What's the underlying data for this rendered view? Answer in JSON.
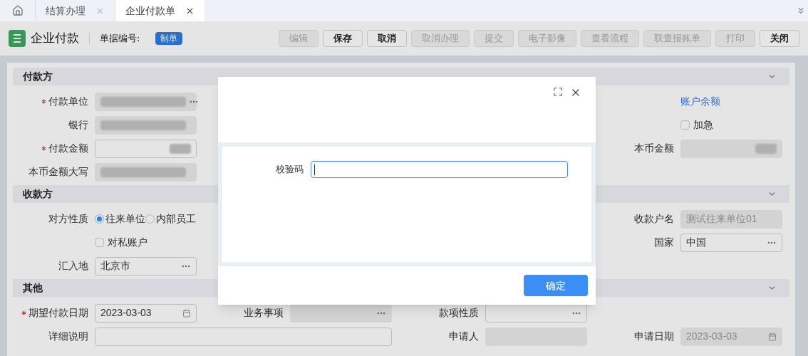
{
  "tabs": [
    {
      "kind": "home",
      "selected": false
    },
    {
      "kind": "tab",
      "label": "结算办理",
      "selected": false
    },
    {
      "kind": "tab",
      "label": "企业付款单",
      "selected": true
    }
  ],
  "toolbar": {
    "title": "企业付款",
    "number_label": "单据编号:",
    "status_badge": "制单",
    "buttons": [
      {
        "label": "编辑",
        "disabled": true
      },
      {
        "label": "保存",
        "disabled": false
      },
      {
        "label": "取消",
        "disabled": false
      },
      {
        "label": "取消办理",
        "disabled": true
      },
      {
        "label": "提交",
        "disabled": true
      },
      {
        "label": "电子影像",
        "disabled": true
      },
      {
        "label": "查看流程",
        "disabled": true
      },
      {
        "label": "联查报账单",
        "disabled": true
      },
      {
        "label": "打印",
        "disabled": true
      },
      {
        "label": "关闭",
        "disabled": false
      }
    ]
  },
  "sections": [
    {
      "title": "付款方",
      "expanded": true,
      "rows": [
        [
          {
            "kind": "masked_picker",
            "label": "付款单位",
            "required": true,
            "disabled": true
          },
          {
            "kind": "empty"
          },
          {
            "kind": "empty"
          },
          {
            "kind": "link",
            "text": "账户余额"
          }
        ],
        [
          {
            "kind": "masked",
            "label": "银行",
            "required": false,
            "disabled": true
          },
          {
            "kind": "empty"
          },
          {
            "kind": "empty"
          },
          {
            "kind": "checkbox",
            "text": "加急",
            "checked": false
          }
        ],
        [
          {
            "kind": "masked_amount",
            "label": "付款金额",
            "required": true,
            "disabled": false
          },
          {
            "kind": "empty"
          },
          {
            "kind": "empty"
          },
          {
            "kind": "masked_amount",
            "label": "本币金额",
            "required": false,
            "disabled": true
          }
        ],
        [
          {
            "kind": "masked",
            "label": "本币金额大写",
            "required": false,
            "disabled": true
          }
        ]
      ]
    },
    {
      "title": "收款方",
      "expanded": true,
      "rows": [
        [
          {
            "kind": "radios",
            "label": "对方性质",
            "options": [
              {
                "text": "往来单位",
                "selected": true
              },
              {
                "text": "内部员工",
                "selected": false
              }
            ]
          },
          {
            "kind": "empty"
          },
          {
            "kind": "empty"
          },
          {
            "kind": "field",
            "label": "收款户名",
            "required": false,
            "disabled": true,
            "value": "测试往来单位01"
          }
        ],
        [
          {
            "kind": "checkbox",
            "text": "对私账户",
            "checked": false
          },
          {
            "kind": "empty"
          },
          {
            "kind": "empty"
          },
          {
            "kind": "picker",
            "label": "国家",
            "required": false,
            "disabled": false,
            "value": "中国"
          }
        ],
        [
          {
            "kind": "picker",
            "label": "汇入地",
            "required": false,
            "disabled": false,
            "value": "北京市"
          }
        ]
      ]
    },
    {
      "title": "其他",
      "expanded": true,
      "rows": [
        [
          {
            "kind": "date",
            "label": "期望付款日期",
            "required": true,
            "disabled": false,
            "value": "2023-03-03"
          },
          {
            "kind": "picker",
            "label": "业务事项",
            "required": false,
            "disabled": true
          },
          {
            "kind": "picker",
            "label": "款项性质",
            "required": false,
            "disabled": false
          },
          {
            "kind": "empty"
          }
        ],
        [
          {
            "kind": "wide_field",
            "label": "详细说明",
            "required": false,
            "disabled": false
          },
          {
            "kind": "spanned"
          },
          {
            "kind": "field",
            "label": "申请人",
            "required": false,
            "disabled": true
          },
          {
            "kind": "date",
            "label": "申请日期",
            "required": false,
            "disabled": true,
            "value": "2023-03-03"
          }
        ]
      ]
    }
  ],
  "dialog": {
    "field_label": "校验码",
    "confirm": "确定"
  }
}
